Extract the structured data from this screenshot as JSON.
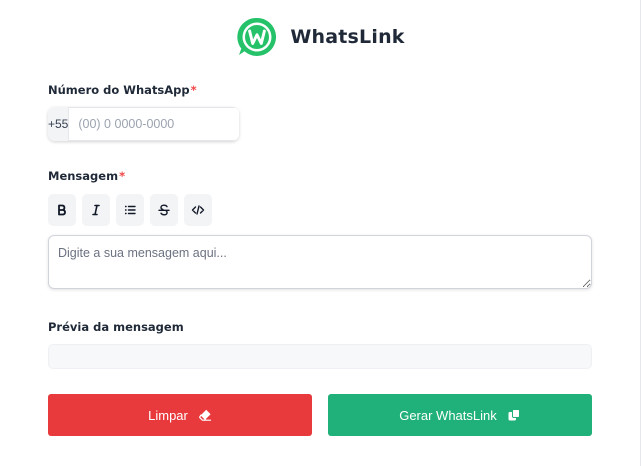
{
  "app": {
    "title": "WhatsLink"
  },
  "icons": {
    "logo": "whatsapp-logo-icon",
    "bold": "bold-icon",
    "italic": "italic-icon",
    "list": "bullet-list-icon",
    "strike": "strikethrough-icon",
    "code": "code-icon",
    "clear": "eraser-icon",
    "generate": "copy-icon"
  },
  "colors": {
    "brand_green": "#20b07a",
    "danger_red": "#e8393d",
    "required": "#ef4444"
  },
  "phone": {
    "label": "Número do WhatsApp",
    "required_mark": "*",
    "prefix": "+55",
    "value": "",
    "placeholder": "(00) 0 0000-0000"
  },
  "message": {
    "label": "Mensagem",
    "required_mark": "*",
    "value": "",
    "placeholder": "Digite a sua mensagem aqui..."
  },
  "preview": {
    "label": "Prévia da mensagem",
    "content": ""
  },
  "buttons": {
    "clear_label": "Limpar",
    "generate_label": "Gerar WhatsLink"
  }
}
